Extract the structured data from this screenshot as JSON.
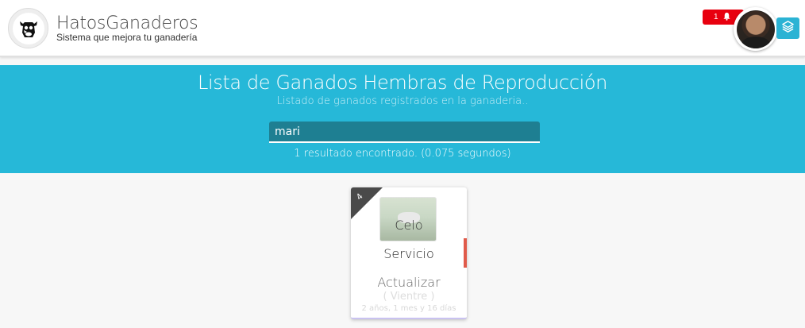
{
  "header": {
    "app_title": "HatosGanaderos",
    "app_subtitle": "Sistema que mejora tu ganadería",
    "logo_icon": "cow-icon",
    "notifications": {
      "count": "1",
      "icon": "bell-icon",
      "color": "#e8000f"
    },
    "avatar_icon": "user-avatar",
    "layers_icon": "layers-icon"
  },
  "banner": {
    "title": "Lista de Ganados Hembras de Reproducción",
    "subtitle": "Listado de ganados registrados en la ganaderia..",
    "search": {
      "value": "mari",
      "placeholder": ""
    },
    "result_text": "1 resultado encontrado. (0.075 segundos)",
    "color": "#26b8d8"
  },
  "cards": [
    {
      "ribbon_number": "4",
      "image_icon": "cattle-photo",
      "status_label": "Celo",
      "action_label": "Servicio",
      "update_link": "Actualizar",
      "vientre": "( Vientre )",
      "edad": "2 años, 1 mes y 16 días",
      "accent_color": "#e05a4a"
    }
  ]
}
